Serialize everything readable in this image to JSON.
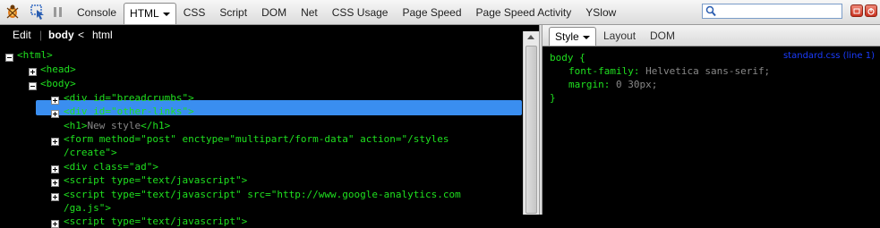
{
  "toolbar": {
    "tabs": [
      "Console",
      "HTML",
      "CSS",
      "Script",
      "DOM",
      "Net",
      "CSS Usage",
      "Page Speed",
      "Page Speed Activity",
      "YSlow"
    ],
    "active_tab": "HTML",
    "search_value": ""
  },
  "breadcrumb": {
    "edit": "Edit",
    "items": [
      "body",
      "html"
    ],
    "separator": "<"
  },
  "tree": {
    "rows": [
      "<html>",
      "<head>",
      "<body>",
      "<div id=\"breadcrumbs\">",
      "<div id=\"other-links\">",
      "New style",
      "<form method=\"post\" enctype=\"multipart/form-data\" action=\"/styles",
      "/create\">",
      "<div class=\"ad\">",
      "<script type=\"text/javascript\">",
      "<script type=\"text/javascript\" src=\"http://www.google-analytics.com",
      "/ga.js\">",
      "<script type=\"text/javascript\">"
    ],
    "h1_open": "<h1>",
    "h1_close": "</h1>"
  },
  "sidepanel": {
    "tabs": [
      "Style",
      "Layout",
      "DOM"
    ],
    "active_tab": "Style",
    "rule": {
      "selector": "body {",
      "source": "standard.css (line 1)",
      "declarations": [
        {
          "prop": "font-family:",
          "value": "Helvetica sans-serif;"
        },
        {
          "prop": "margin:",
          "value": "0 30px;"
        }
      ],
      "close": "}"
    }
  },
  "colors": {
    "tag": "#1fe01f",
    "selection": "#3a8ef0",
    "text_node": "#888888",
    "source_link": "#1a3cff"
  }
}
